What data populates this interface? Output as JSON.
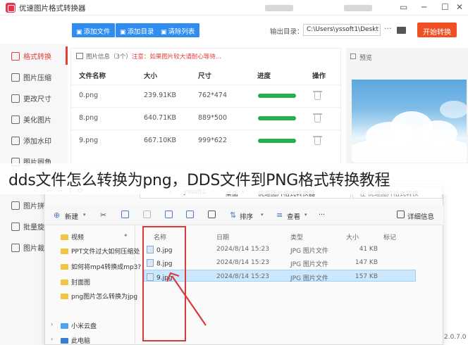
{
  "app": {
    "title": "优速图片格式转换器"
  },
  "toolbar": {
    "add_file": "添加文件",
    "add_dir": "添加目录",
    "clear_list": "清除列表",
    "output_dir_label": "输出目录：",
    "output_dir_value": "C:\\Users\\yssoft1\\Deskt",
    "dots": "···",
    "start": "开始转换"
  },
  "sidebar": {
    "items": [
      {
        "label": "格式转换"
      },
      {
        "label": "图片压缩"
      },
      {
        "label": "更改尺寸"
      },
      {
        "label": "美化图片"
      },
      {
        "label": "添加水印"
      },
      {
        "label": "图片圆角"
      },
      {
        "label": "图片拼"
      },
      {
        "label": "批量旋"
      },
      {
        "label": "图片裁"
      }
    ]
  },
  "file_panel": {
    "info_label": "图片信息（3个）",
    "info_hint": "注意：如果图片较大请耐心等待...",
    "columns": [
      "文件名称",
      "大小",
      "尺寸",
      "进度",
      "操作"
    ],
    "rows": [
      {
        "name": "0.png",
        "size": "239.91KB",
        "dims": "762*474",
        "progress": 1.0
      },
      {
        "name": "8.png",
        "size": "640.71KB",
        "dims": "889*500",
        "progress": 1.0
      },
      {
        "name": "9.png",
        "size": "667.10KB",
        "dims": "999*622",
        "progress": 1.0
      }
    ]
  },
  "preview": {
    "label": "预览"
  },
  "caption": "dds文件怎么转换为png，DDS文件到PNG格式转换教程",
  "explorer": {
    "breadcrumb": [
      "yssoft1",
      "桌面",
      "优速图片格式转换器"
    ],
    "search_placeholder": "在 优速图片格式转换",
    "commands": {
      "new": "新建",
      "sort": "排序",
      "view": "查看",
      "more": "···",
      "details": "详细信息"
    },
    "nav_items": [
      {
        "label": "视频"
      },
      {
        "label": "PPT文件过大如何压缩处"
      },
      {
        "label": "如何将mp4转换成mp3?"
      },
      {
        "label": "封面图"
      },
      {
        "label": "png图片怎么转换为jpg"
      },
      {
        "label": "小米云盘"
      },
      {
        "label": "此电脑"
      }
    ],
    "columns": [
      "名称",
      "日期",
      "类型",
      "大小",
      "标记"
    ],
    "files": [
      {
        "name": "0.jpg",
        "date": "2024/8/14 15:23",
        "type": "JPG 图片文件",
        "size": "41 KB"
      },
      {
        "name": "8.jpg",
        "date": "2024/8/14 15:23",
        "type": "JPG 图片文件",
        "size": "147 KB"
      },
      {
        "name": "9.jpg",
        "date": "2024/8/14 15:23",
        "type": "JPG 图片文件",
        "size": "157 KB"
      }
    ]
  },
  "version": "2.0.7.0",
  "colors": {
    "accent_blue": "#2f8df2",
    "accent_red": "#e2413a",
    "start_orange": "#f04e23",
    "progress_green": "#22b14c"
  }
}
